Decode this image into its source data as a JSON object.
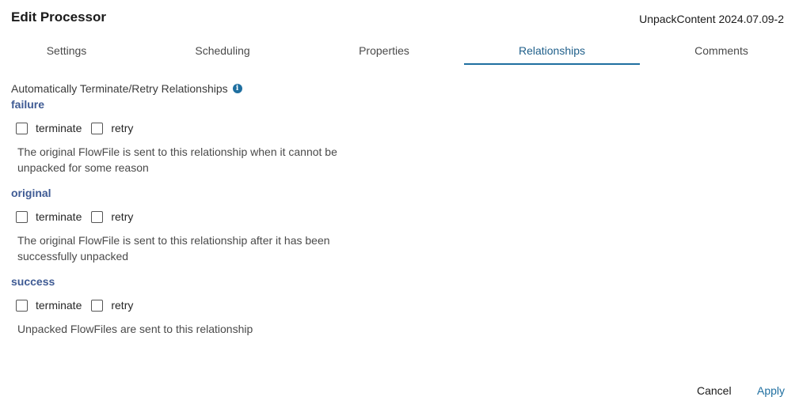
{
  "dialog": {
    "title": "Edit Processor",
    "version": "UnpackContent 2024.07.09-2"
  },
  "tabs": [
    {
      "label": "Settings"
    },
    {
      "label": "Scheduling"
    },
    {
      "label": "Properties"
    },
    {
      "label": "Relationships"
    },
    {
      "label": "Comments"
    }
  ],
  "active_tab": "Relationships",
  "section": {
    "heading": "Automatically Terminate/Retry Relationships",
    "info_icon": "info-icon"
  },
  "relationships": [
    {
      "name": "failure",
      "terminate_label": "terminate",
      "retry_label": "retry",
      "terminate_checked": false,
      "retry_checked": false,
      "description_line1": "The original FlowFile is sent to this relationship when it cannot be",
      "description_line2": "unpacked for some reason"
    },
    {
      "name": "original",
      "terminate_label": "terminate",
      "retry_label": "retry",
      "terminate_checked": false,
      "retry_checked": false,
      "description_line1": "The original FlowFile is sent to this relationship after it has been",
      "description_line2": "successfully unpacked"
    },
    {
      "name": "success",
      "terminate_label": "terminate",
      "retry_label": "retry",
      "terminate_checked": false,
      "retry_checked": false,
      "description_line1": "Unpacked FlowFiles are sent to this relationship",
      "description_line2": ""
    }
  ],
  "footer": {
    "cancel_label": "Cancel",
    "apply_label": "Apply"
  },
  "colors": {
    "accent": "#1f6fa0",
    "relationship_name": "#3f5b94"
  }
}
